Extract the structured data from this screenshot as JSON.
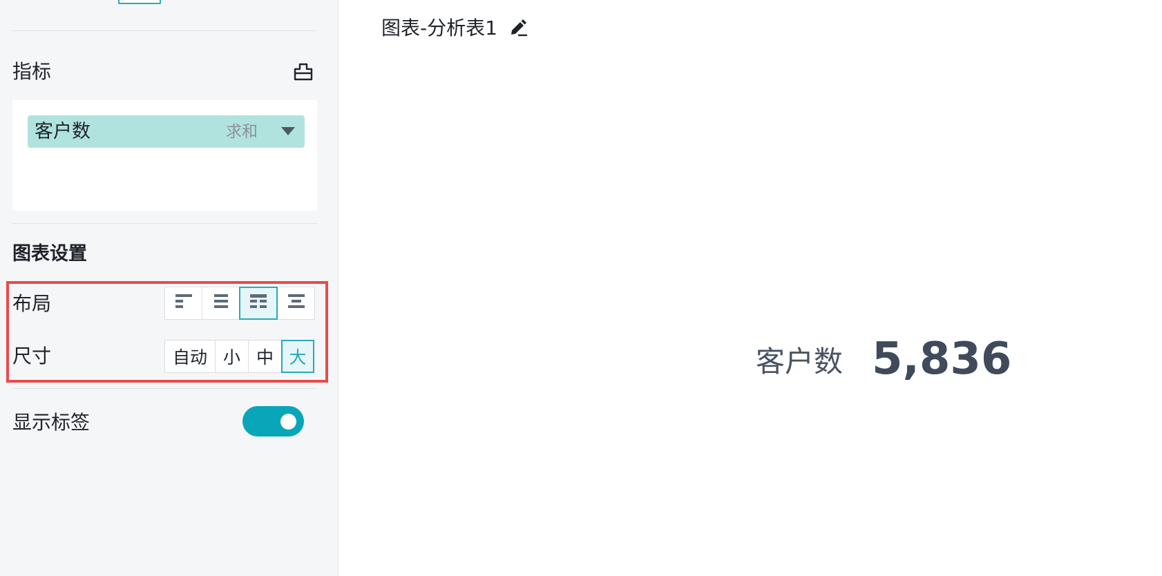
{
  "metrics": {
    "title": "指标",
    "tool_icon": "field-tool-icon",
    "field": {
      "name": "客户数",
      "aggregation": "求和",
      "dropdown_icon": "triangle-down-icon"
    }
  },
  "chart_settings": {
    "title": "图表设置",
    "layout": {
      "label": "布局",
      "options": [
        "layout-left-align-icon",
        "layout-list-icon",
        "layout-two-column-icon",
        "layout-center-icon"
      ],
      "selected_index": 2
    },
    "size": {
      "label": "尺寸",
      "options": [
        "自动",
        "小",
        "中",
        "大"
      ],
      "selected": "大"
    },
    "show_labels": {
      "label": "显示标签",
      "enabled": true
    }
  },
  "canvas": {
    "title": "图表-分析表1",
    "edit_icon": "pencil-icon",
    "kpi": {
      "label": "客户数",
      "value": "5,836"
    }
  },
  "colors": {
    "accent": "#26a9b9",
    "toggle_on": "#08a6b8",
    "chip_bg": "#b1e3de",
    "highlight_border": "#ea4a4a",
    "kpi_value": "#3f4a5a"
  }
}
